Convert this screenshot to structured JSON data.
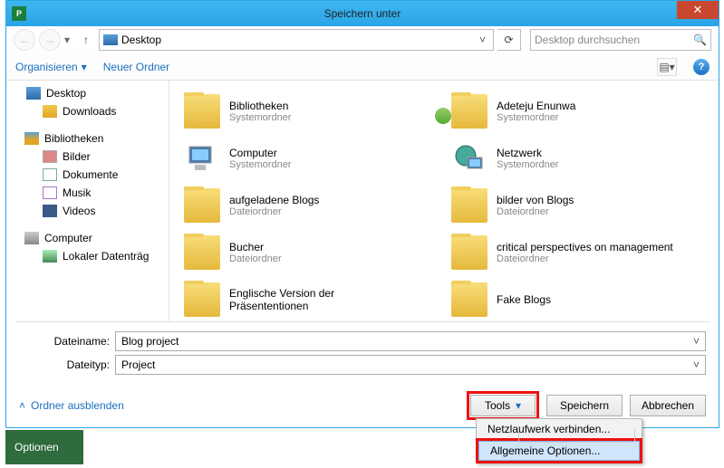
{
  "titlebar": {
    "title": "Speichern unter"
  },
  "nav": {
    "location": "Desktop",
    "search_placeholder": "Desktop durchsuchen"
  },
  "toolbar": {
    "organize": "Organisieren",
    "newfolder": "Neuer Ordner"
  },
  "tree": {
    "desktop": "Desktop",
    "downloads": "Downloads",
    "lib_header": "Bibliotheken",
    "pictures": "Bilder",
    "documents": "Dokumente",
    "music": "Musik",
    "videos": "Videos",
    "computer": "Computer",
    "localdisk": "Lokaler Datenträg"
  },
  "files": {
    "sysfolder": "Systemordner",
    "filefolder": "Dateiordner",
    "items": [
      {
        "name": "Bibliotheken"
      },
      {
        "name": "Adeteju Enunwa"
      },
      {
        "name": "Computer"
      },
      {
        "name": "Netzwerk"
      },
      {
        "name": "aufgeladene Blogs"
      },
      {
        "name": "bilder von Blogs"
      },
      {
        "name": "Bucher"
      },
      {
        "name": "critical perspectives on management"
      },
      {
        "name_line1": "Englische Version der",
        "name_line2": "Präsententionen"
      },
      {
        "name": "Fake Blogs"
      }
    ]
  },
  "fields": {
    "filename_label": "Dateiname:",
    "filename_value": "Blog project",
    "filetype_label": "Dateityp:",
    "filetype_value": "Project"
  },
  "bottom": {
    "hide": "Ordner ausblenden",
    "tools": "Tools",
    "save": "Speichern",
    "cancel": "Abbrechen"
  },
  "menu": {
    "map_drive": "Netzlaufwerk verbinden...",
    "general_options": "Allgemeine Optionen..."
  },
  "ribbon": {
    "options": "Optionen"
  }
}
